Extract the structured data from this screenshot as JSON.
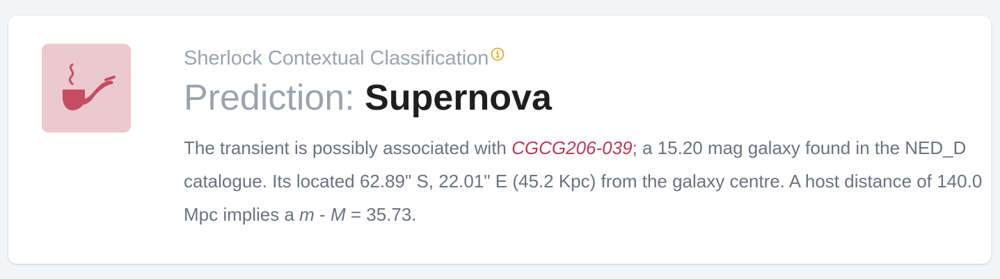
{
  "card": {
    "subtitle": "Sherlock Contextual Classification",
    "info_icon": "info-icon",
    "prediction_label": "Prediction: ",
    "prediction_value": "Supernova",
    "icon": "pipe-icon",
    "colors": {
      "tile_background": "#ecc8cf",
      "pipe": "#c54d62",
      "info": "#e0a422",
      "link": "#b93a52"
    },
    "description": {
      "part1": "The transient is possibly associated with ",
      "host_name": "CGCG206-039",
      "part2": "; a 15.20 mag galaxy found in the NED_D catalogue. Its located 62.89\" S, 22.01\" E (45.2 Kpc) from the galaxy centre. A host distance of 140.0 Mpc implies a ",
      "math_m": "m",
      "math_sep": " - ",
      "math_M": "M",
      "math_eq": " = 35.73."
    }
  }
}
